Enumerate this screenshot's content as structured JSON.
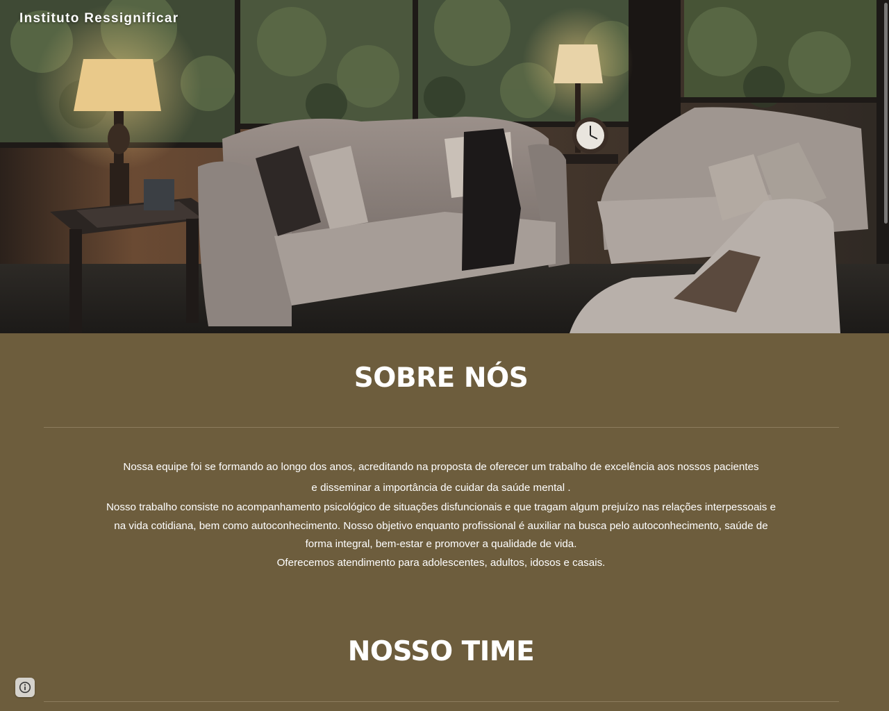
{
  "header": {
    "site_title": "Instituto Ressignificar"
  },
  "about": {
    "heading": "SOBRE NÓS",
    "paragraphs": [
      "Nossa equipe foi se formando ao longo dos anos, acreditando na proposta de oferecer um trabalho de excelência aos nossos pacientes",
      "e disseminar a importância de cuidar da saúde mental .",
      "Nosso trabalho consiste no acompanhamento psicológico de situações disfuncionais e que tragam algum prejuízo nas relações interpessoais e na vida cotidiana, bem como autoconhecimento. Nosso objetivo enquanto profissional é auxiliar na busca pelo autoconhecimento, saúde de forma integral, bem-estar e promover a qualidade de vida.",
      "Oferecemos atendimento para adolescentes, adultos, idosos e casais."
    ]
  },
  "team": {
    "heading": "NOSSO TIME"
  },
  "colors": {
    "content_background": "#6d5d3d",
    "text": "#ffffff",
    "divider": "#8c7d5e"
  },
  "icons": {
    "info_button": "info-icon"
  }
}
